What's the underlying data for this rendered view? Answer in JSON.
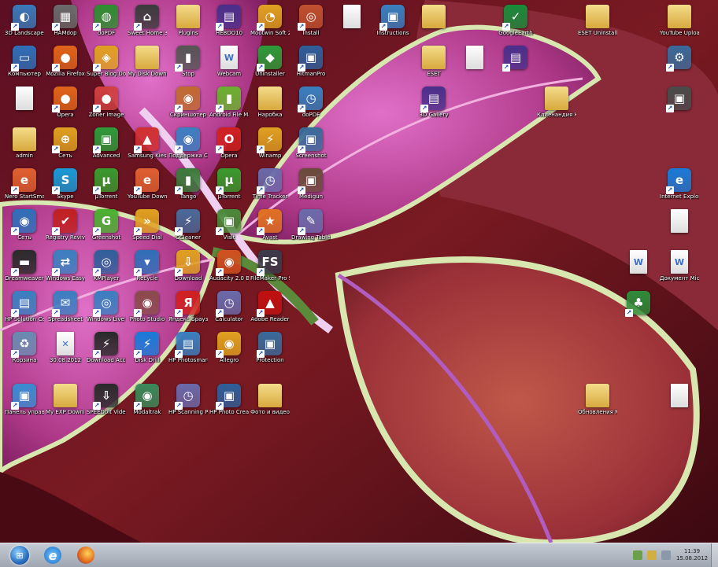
{
  "desktop": {
    "icons": [
      {
        "label": "3D Landscape Deluxe 2.0",
        "kind": "app",
        "glyph": "◐",
        "color": "#3a78b8"
      },
      {
        "label": "HAMdop",
        "kind": "app",
        "glyph": "▦",
        "color": "#6a6a6a"
      },
      {
        "label": "doPDF",
        "kind": "app",
        "glyph": "◍",
        "color": "#2f8d2f"
      },
      {
        "label": "Sweet Home 3D",
        "kind": "app",
        "glyph": "⌂",
        "color": "#3b3b3b"
      },
      {
        "label": "Plugins",
        "kind": "folder",
        "glyph": "",
        "color": "#e0b84a"
      },
      {
        "label": "HEBDO10",
        "kind": "app",
        "glyph": "▤",
        "color": "#4a2f8a"
      },
      {
        "label": "Mootwin Soft 2",
        "kind": "app",
        "glyph": "◔",
        "color": "#e0a020"
      },
      {
        "label": "Install",
        "kind": "app",
        "glyph": "◎",
        "color": "#c0502f"
      },
      {
        "label": "",
        "kind": "doc",
        "glyph": "",
        "color": "#ffffff"
      },
      {
        "label": "Instructions",
        "kind": "app",
        "glyph": "▣",
        "color": "#3a7fc0"
      },
      {
        "label": "",
        "kind": "folder",
        "glyph": "",
        "color": "#e0b84a"
      },
      {
        "label": "GoogleEarth",
        "kind": "app",
        "glyph": "✓",
        "color": "#1a8a3a"
      },
      {
        "label": "ESET Uninstaller",
        "kind": "folder",
        "glyph": "",
        "color": "#e0b84a"
      },
      {
        "label": "YouTube Uploader 3.3",
        "kind": "folder",
        "glyph": "",
        "color": "#e0b84a"
      },
      {
        "label": "Компьютер",
        "kind": "app",
        "glyph": "▭",
        "color": "#2f6fb8"
      },
      {
        "label": "Mozilla Firefox",
        "kind": "app",
        "glyph": "●",
        "color": "#e0641a"
      },
      {
        "label": "Super Blog Downloader",
        "kind": "app",
        "glyph": "◈",
        "color": "#e0a020"
      },
      {
        "label": "My Disk Downloads",
        "kind": "folder",
        "glyph": "",
        "color": "#e0b84a"
      },
      {
        "label": "Stop",
        "kind": "app",
        "glyph": "▮",
        "color": "#555555"
      },
      {
        "label": "Webcam",
        "kind": "doc",
        "glyph": "W",
        "color": "#ffffff"
      },
      {
        "label": "Uninstaller",
        "kind": "app",
        "glyph": "◆",
        "color": "#2f9a3a"
      },
      {
        "label": "HitmanPro",
        "kind": "app",
        "glyph": "▣",
        "color": "#2f5f9a"
      },
      {
        "label": "ESET",
        "kind": "folder",
        "glyph": "",
        "color": "#e0b84a"
      },
      {
        "label": "",
        "kind": "doc",
        "glyph": "",
        "color": "#ffffff"
      },
      {
        "label": "",
        "kind": "app",
        "glyph": "▤",
        "color": "#4a2f8a"
      },
      {
        "label": "",
        "kind": "app",
        "glyph": "⚙",
        "color": "#3a6a9a"
      },
      {
        "label": "",
        "kind": "doc",
        "glyph": "",
        "color": "#ffffff"
      },
      {
        "label": "Opera",
        "kind": "app",
        "glyph": "●",
        "color": "#e0641a"
      },
      {
        "label": "Zoner Image",
        "kind": "app",
        "glyph": "●",
        "color": "#d04040"
      },
      {
        "label": "Скриншотер",
        "kind": "app",
        "glyph": "◉",
        "color": "#c06a30"
      },
      {
        "label": "Android File Manager",
        "kind": "app",
        "glyph": "▮",
        "color": "#6ab02f"
      },
      {
        "label": "Наробка",
        "kind": "folder",
        "glyph": "",
        "color": "#e0b84a"
      },
      {
        "label": "doPDF",
        "kind": "app",
        "glyph": "◷",
        "color": "#3a7fc0"
      },
      {
        "label": "3D Gallery",
        "kind": "app",
        "glyph": "▤",
        "color": "#4a2f8a"
      },
      {
        "label": "Клиенандия Карвонн",
        "kind": "folder",
        "glyph": "",
        "color": "#e0b84a"
      },
      {
        "label": "",
        "kind": "app",
        "glyph": "▣",
        "color": "#4a4a4a"
      },
      {
        "label": "admin",
        "kind": "folder",
        "glyph": "",
        "color": "#e0b84a"
      },
      {
        "label": "Сеть",
        "kind": "app",
        "glyph": "⊕",
        "color": "#e0a020"
      },
      {
        "label": "Advanced",
        "kind": "app",
        "glyph": "▣",
        "color": "#2f9a3a"
      },
      {
        "label": "Samsung Kies",
        "kind": "app",
        "glyph": "▲",
        "color": "#d03030"
      },
      {
        "label": "Поддержка Classic Shell",
        "kind": "app",
        "glyph": "◉",
        "color": "#3a7fc0"
      },
      {
        "label": "Opera",
        "kind": "app",
        "glyph": "O",
        "color": "#d02020"
      },
      {
        "label": "Winamp",
        "kind": "app",
        "glyph": "⚡",
        "color": "#e0a020"
      },
      {
        "label": "Screenshot",
        "kind": "app",
        "glyph": "▣",
        "color": "#3a6a9a"
      },
      {
        "label": "Nero StartSmart",
        "kind": "app",
        "glyph": "e",
        "color": "#e06030"
      },
      {
        "label": "Skype",
        "kind": "app",
        "glyph": "S",
        "color": "#1a9ad6"
      },
      {
        "label": "µTorrent",
        "kind": "app",
        "glyph": "µ",
        "color": "#3a9a2f"
      },
      {
        "label": "YouTube Downloader",
        "kind": "app",
        "glyph": "e",
        "color": "#e06030"
      },
      {
        "label": "Tango",
        "kind": "app",
        "glyph": "▮",
        "color": "#3a7a3a"
      },
      {
        "label": "µTorrent",
        "kind": "app",
        "glyph": "µ",
        "color": "#3a9a2f"
      },
      {
        "label": "Time Tracker",
        "kind": "app",
        "glyph": "◷",
        "color": "#6a6aaa"
      },
      {
        "label": "Medigun",
        "kind": "app",
        "glyph": "▣",
        "color": "#6a4a3a"
      },
      {
        "label": "Internet Explorer",
        "kind": "app",
        "glyph": "e",
        "color": "#1a7ad6"
      },
      {
        "label": "Сеть",
        "kind": "app",
        "glyph": "◉",
        "color": "#2f6fb8"
      },
      {
        "label": "Registry Reviver",
        "kind": "app",
        "glyph": "✔",
        "color": "#c02020"
      },
      {
        "label": "Greenshot",
        "kind": "app",
        "glyph": "G",
        "color": "#4ab02f"
      },
      {
        "label": "Speed Dial",
        "kind": "app",
        "glyph": "»",
        "color": "#e0a020"
      },
      {
        "label": "CCleaner",
        "kind": "app",
        "glyph": "⚡",
        "color": "#4a6a9a"
      },
      {
        "label": "Visit",
        "kind": "app",
        "glyph": "▣",
        "color": "#4a8a3a"
      },
      {
        "label": "Avast",
        "kind": "app",
        "glyph": "★",
        "color": "#e07020"
      },
      {
        "label": "Drawing Tablet",
        "kind": "app",
        "glyph": "✎",
        "color": "#6a6aaa"
      },
      {
        "label": "",
        "kind": "doc",
        "glyph": "",
        "color": "#ffffff"
      },
      {
        "label": "Dreamweaver",
        "kind": "app",
        "glyph": "▬",
        "color": "#2a2a2a"
      },
      {
        "label": "Windows Easy Transfer",
        "kind": "app",
        "glyph": "⇄",
        "color": "#3a7fc0"
      },
      {
        "label": "KMPlayer",
        "kind": "app",
        "glyph": "◎",
        "color": "#2f5f9a"
      },
      {
        "label": "Recycle",
        "kind": "app",
        "glyph": "▾",
        "color": "#2f6fb8"
      },
      {
        "label": "Download",
        "kind": "app",
        "glyph": "⇩",
        "color": "#e0a020"
      },
      {
        "label": "Audacity 2.0 Beta Daily",
        "kind": "app",
        "glyph": "◉",
        "color": "#d05020"
      },
      {
        "label": "FileMaker Pro Studio",
        "kind": "app",
        "glyph": "FS",
        "color": "#3a3a4a"
      },
      {
        "label": "",
        "kind": "doc",
        "glyph": "W",
        "color": "#ffffff"
      },
      {
        "label": "Документ Microsoft",
        "kind": "doc",
        "glyph": "W",
        "color": "#ffffff"
      },
      {
        "label": "HP Solution Center",
        "kind": "app",
        "glyph": "▤",
        "color": "#3a7fc0"
      },
      {
        "label": "Spreadsheet",
        "kind": "app",
        "glyph": "✉",
        "color": "#3a7fc0"
      },
      {
        "label": "Windows Live Movie",
        "kind": "app",
        "glyph": "◎",
        "color": "#3a7fc0"
      },
      {
        "label": "Photo Studio",
        "kind": "app",
        "glyph": "◉",
        "color": "#8a4a4a"
      },
      {
        "label": "Яндекс Браузер",
        "kind": "app",
        "glyph": "Я",
        "color": "#d02020"
      },
      {
        "label": "Calculator",
        "kind": "app",
        "glyph": "◷",
        "color": "#6a6aaa"
      },
      {
        "label": "Adobe Reader",
        "kind": "app",
        "glyph": "▲",
        "color": "#c01010"
      },
      {
        "label": "",
        "kind": "app",
        "glyph": "♣",
        "color": "#2f8a3a"
      },
      {
        "label": "Корзина",
        "kind": "app",
        "glyph": "♻",
        "color": "#6a8ab0"
      },
      {
        "label": "30.08.2012",
        "kind": "doc",
        "glyph": "✕",
        "color": "#ffffff"
      },
      {
        "label": "Download Accelerator",
        "kind": "app",
        "glyph": "⚡",
        "color": "#2a2a2a"
      },
      {
        "label": "Disk Drill",
        "kind": "app",
        "glyph": "⚡",
        "color": "#1a7ad6"
      },
      {
        "label": "HP Photosmart",
        "kind": "app",
        "glyph": "▤",
        "color": "#3a7fc0"
      },
      {
        "label": "Allegro",
        "kind": "app",
        "glyph": "◉",
        "color": "#e0a020"
      },
      {
        "label": "Protection",
        "kind": "app",
        "glyph": "▣",
        "color": "#3a6a9a"
      },
      {
        "label": "Панель управления",
        "kind": "app",
        "glyph": "▣",
        "color": "#3a8ad0"
      },
      {
        "label": "My EXP Downloads",
        "kind": "folder",
        "glyph": "",
        "color": "#e0b84a"
      },
      {
        "label": "SPEEDbit Video Downloader",
        "kind": "app",
        "glyph": "⇩",
        "color": "#2a2a2a"
      },
      {
        "label": "Modaltrak",
        "kind": "app",
        "glyph": "◉",
        "color": "#3a8a5a"
      },
      {
        "label": "HP Scanning Pro",
        "kind": "app",
        "glyph": "◷",
        "color": "#6a6aaa"
      },
      {
        "label": "HP Photo Creations",
        "kind": "app",
        "glyph": "▣",
        "color": "#2f5f9a"
      },
      {
        "label": "Фото и видео",
        "kind": "folder",
        "glyph": "",
        "color": "#e0b84a"
      },
      {
        "label": "Обновления Microsoft",
        "kind": "folder",
        "glyph": "",
        "color": "#e0b84a"
      },
      {
        "label": "",
        "kind": "doc",
        "glyph": "",
        "color": "#ffffff"
      }
    ]
  },
  "taskbar": {
    "start_label": "Start",
    "pinned": [
      {
        "name": "Internet Explorer"
      },
      {
        "name": "Mozilla Firefox"
      }
    ],
    "clock": {
      "time": "11:39",
      "date": "15.08.2012"
    }
  }
}
